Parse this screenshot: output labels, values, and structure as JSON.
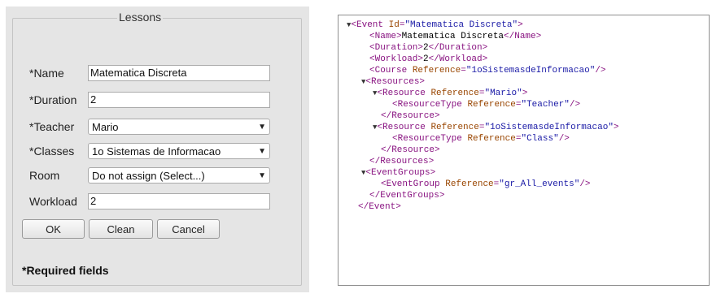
{
  "form": {
    "legend": "Lessons",
    "fields": {
      "name": {
        "label": "*Name",
        "value": "Matematica Discreta"
      },
      "duration": {
        "label": "*Duration",
        "value": "2"
      },
      "teacher": {
        "label": "*Teacher",
        "value": "Mario"
      },
      "classes": {
        "label": "*Classes",
        "value": "1o Sistemas de Informacao"
      },
      "room": {
        "label": "Room",
        "value": "Do not assign (Select...)"
      },
      "workload": {
        "label": "Workload",
        "value": "2"
      }
    },
    "buttons": {
      "ok": "OK",
      "clean": "Clean",
      "cancel": "Cancel"
    },
    "required_note": "*Required fields"
  },
  "xml": {
    "event_id": "Matematica Discreta",
    "name": "Matematica Discreta",
    "duration": "2",
    "workload": "2",
    "course_ref": "1oSistemasdeInformacao",
    "teacher_ref": "Mario",
    "teacher_type": "Teacher",
    "class_ref": "1oSistemasdeInformacao",
    "class_type": "Class",
    "eventgroup_ref": "gr_All_events"
  },
  "icons": {
    "dropdown": "dropdown-arrow-icon",
    "toggle": "disclosure-triangle-icon"
  }
}
